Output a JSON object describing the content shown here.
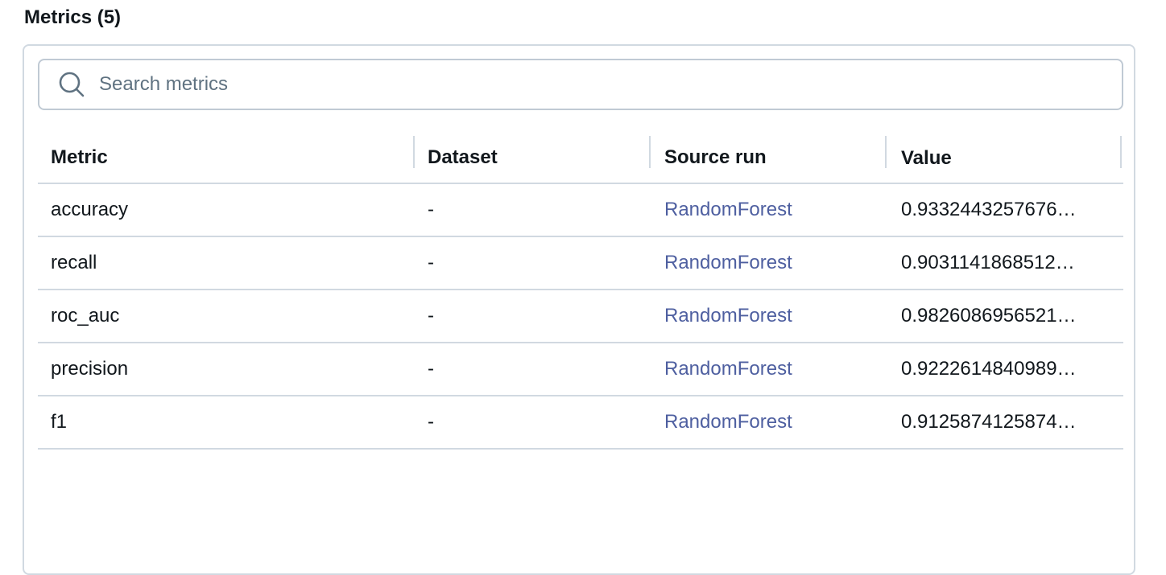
{
  "section": {
    "title": "Metrics (5)"
  },
  "search": {
    "placeholder": "Search metrics",
    "value": ""
  },
  "table": {
    "headers": {
      "metric": "Metric",
      "dataset": "Dataset",
      "source_run": "Source run",
      "value": "Value"
    },
    "rows": [
      {
        "metric": "accuracy",
        "dataset": "-",
        "source_run": "RandomForest",
        "value": "0.9332443257676…"
      },
      {
        "metric": "recall",
        "dataset": "-",
        "source_run": "RandomForest",
        "value": "0.9031141868512…"
      },
      {
        "metric": "roc_auc",
        "dataset": "-",
        "source_run": "RandomForest",
        "value": "0.9826086956521…"
      },
      {
        "metric": "precision",
        "dataset": "-",
        "source_run": "RandomForest",
        "value": "0.9222614840989…"
      },
      {
        "metric": "f1",
        "dataset": "-",
        "source_run": "RandomForest",
        "value": "0.9125874125874…"
      }
    ]
  },
  "colors": {
    "link": "#4e5fa0",
    "border": "#d1d9e1",
    "text": "#11171c",
    "placeholder": "#5f7281"
  },
  "icons": {
    "search": "search-icon"
  }
}
